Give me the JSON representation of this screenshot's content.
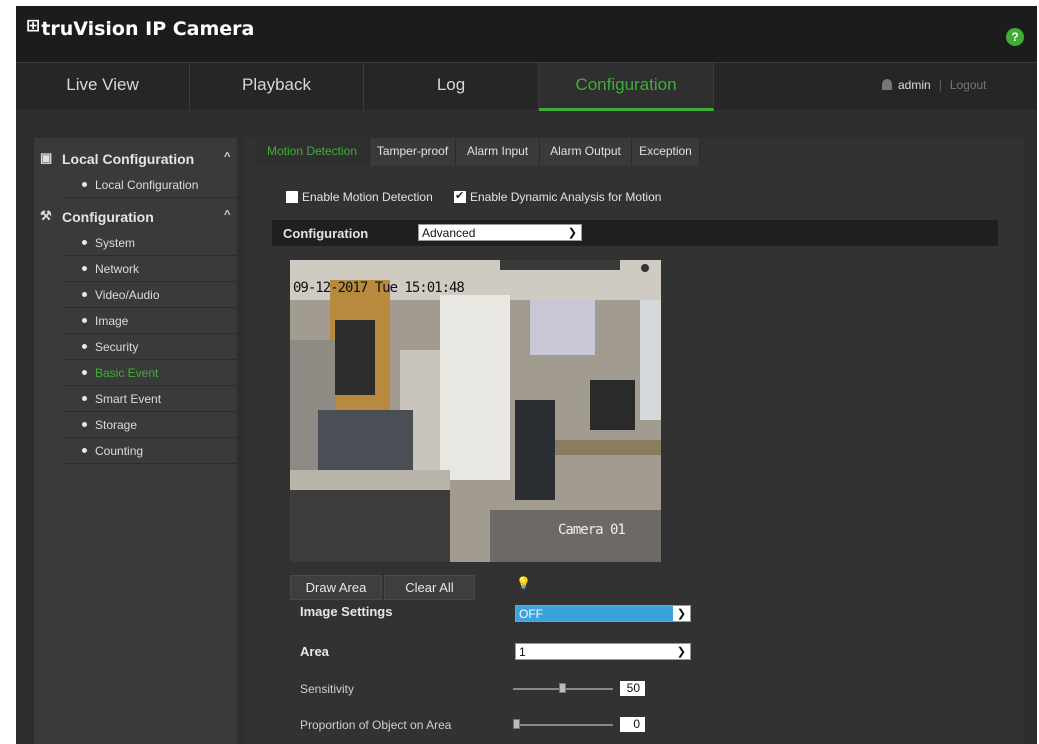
{
  "header": {
    "logo_text": "truVision IP Camera",
    "help_label": "?"
  },
  "nav": {
    "tabs": [
      {
        "label": "Live View"
      },
      {
        "label": "Playback"
      },
      {
        "label": "Log"
      },
      {
        "label": "Configuration",
        "active": true
      }
    ],
    "user": "admin",
    "logout": "Logout"
  },
  "sidebar": {
    "groups": [
      {
        "label": "Local Configuration",
        "icon": "local-config-icon",
        "items": [
          "Local Configuration"
        ]
      },
      {
        "label": "Configuration",
        "icon": "wrench-icon",
        "items": [
          "System",
          "Network",
          "Video/Audio",
          "Image",
          "Security",
          "Basic Event",
          "Smart Event",
          "Storage",
          "Counting"
        ],
        "active_item": "Basic Event"
      }
    ]
  },
  "subtabs": [
    "Motion Detection",
    "Tamper-proof",
    "Alarm Input",
    "Alarm Output",
    "Exception"
  ],
  "motion": {
    "enable_motion": {
      "label": "Enable Motion Detection",
      "checked": false
    },
    "enable_dynamic": {
      "label": "Enable Dynamic Analysis for Motion",
      "checked": true
    },
    "config_label": "Configuration",
    "config_value": "Advanced",
    "osd_time": "09-12-2017 Tue 15:01:48",
    "osd_camera": "Camera 01",
    "draw_area": "Draw Area",
    "clear_all": "Clear All",
    "image_settings_label": "Image Settings",
    "image_settings_value": "OFF",
    "area_label": "Area",
    "area_value": "1",
    "sensitivity_label": "Sensitivity",
    "sensitivity_value": "50",
    "proportion_label": "Proportion of Object on Area",
    "proportion_value": "0"
  },
  "colors": {
    "accent": "#3fae35",
    "select_highlight": "#3aa2dc"
  }
}
